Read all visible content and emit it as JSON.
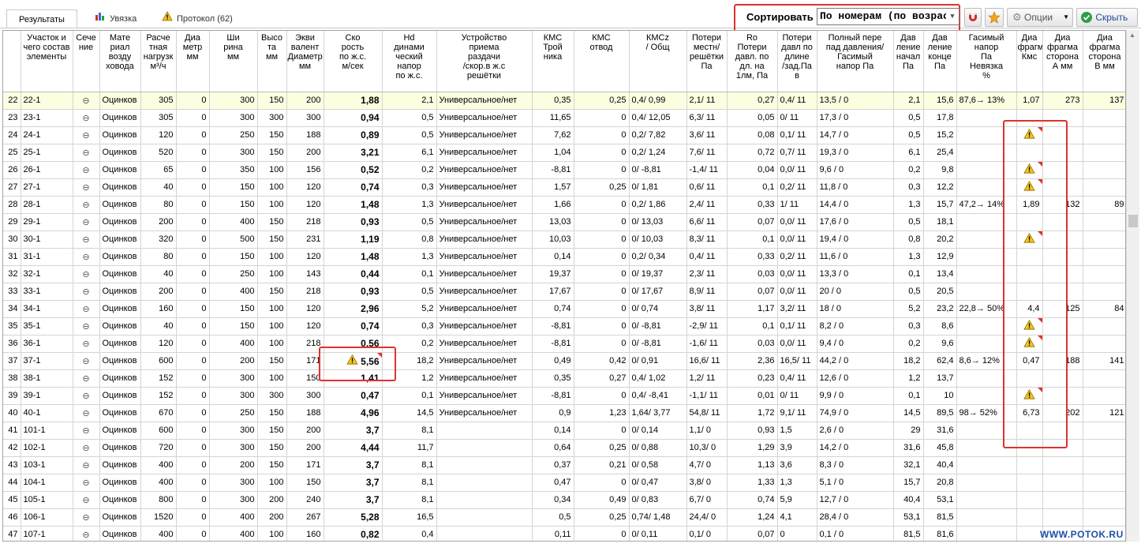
{
  "tabs": [
    {
      "label": "Результаты",
      "icon": "results-tab"
    },
    {
      "label": "Увязка",
      "icon": "bar-chart-icon"
    },
    {
      "label": "Протокол (62)",
      "icon": "warning-icon"
    }
  ],
  "sort": {
    "label": "Сортировать",
    "value": "По номерам (по возрастанию)"
  },
  "toolbar": {
    "options_label": "Опции",
    "hide_label": "Скрыть"
  },
  "brand": "WWW.POTOK.RU",
  "columns": [
    "",
    "Участок и\nчего состав\nэлементы",
    "Сече\nние",
    "Мате\nриал\nвозду\nховода",
    "Расче\nтная\nнагрузк\nм³/ч",
    "Диа\nметр\nмм",
    "Ши\nрина\nмм",
    "Высо\nта\nмм",
    "Экви\nвалент\nДиаметр\nмм",
    "Ско\nрость\nпо ж.с.\nм/сек",
    "Hd\nдинами\nческий\nнапор\nпо ж.с.",
    "Устройство\nприема\nраздачи\n/скор.в ж.с\nрешётки",
    "КМС\nТрой\nника",
    "КМС\nотвод",
    "КМСz\n/ Общ",
    "Потери\nместн/\nрешётки\nПа",
    "Ro\nПотери\nдавл. по\nдл. на\n1лм, Па",
    "Потери\nдавл по\nдлине\n/зад.Па\nв",
    "Полный пере\nпад давления/\nГасимый\nнапор Па",
    "Дав\nление\nначал\nПа",
    "Дав\nление\nконце\nПа",
    "Гасимый\nнапор\nПа\nНевязка\n%",
    "Диа\nфрагма\nКмс",
    "Диа\nфрагма\nсторона\nА мм",
    "Диа\nфрагма\nсторона\nВ мм"
  ],
  "rows": [
    [
      "22",
      "22-1",
      "⊖",
      "Оцинков",
      "305",
      "0",
      "300",
      "150",
      "200",
      "1,88",
      "2,1",
      "Универсальное/нет",
      "0,35",
      "0,25",
      "0,4/ 0,99",
      "2,1/ 11",
      "0,27",
      "0,4/ 11",
      "13,5 / 0",
      "2,1",
      "15,6",
      "87,6→ 13%",
      "1,07",
      "273",
      "137"
    ],
    [
      "23",
      "23-1",
      "⊖",
      "Оцинков",
      "305",
      "0",
      "300",
      "300",
      "300",
      "0,94",
      "0,5",
      "Универсальное/нет",
      "11,65",
      "0",
      "0,4/ 12,05",
      "6,3/ 11",
      "0,05",
      "0/ 11",
      "17,3 / 0",
      "0,5",
      "17,8",
      "",
      "",
      "",
      ""
    ],
    [
      "24",
      "24-1",
      "⊖",
      "Оцинков",
      "120",
      "0",
      "250",
      "150",
      "188",
      "0,89",
      "0,5",
      "Универсальное/нет",
      "7,62",
      "0",
      "0,2/ 7,82",
      "3,6/ 11",
      "0,08",
      "0,1/ 11",
      "14,7 / 0",
      "0,5",
      "15,2",
      "",
      "!",
      "",
      ""
    ],
    [
      "25",
      "25-1",
      "⊖",
      "Оцинков",
      "520",
      "0",
      "300",
      "150",
      "200",
      "3,21",
      "6,1",
      "Универсальное/нет",
      "1,04",
      "0",
      "0,2/ 1,24",
      "7,6/ 11",
      "0,72",
      "0,7/ 11",
      "19,3 / 0",
      "6,1",
      "25,4",
      "",
      "",
      "",
      ""
    ],
    [
      "26",
      "26-1",
      "⊖",
      "Оцинков",
      "65",
      "0",
      "350",
      "100",
      "156",
      "0,52",
      "0,2",
      "Универсальное/нет",
      "-8,81",
      "0",
      "0/ -8,81",
      "-1,4/ 11",
      "0,04",
      "0,0/ 11",
      "9,6 / 0",
      "0,2",
      "9,8",
      "",
      "!",
      "",
      ""
    ],
    [
      "27",
      "27-1",
      "⊖",
      "Оцинков",
      "40",
      "0",
      "150",
      "100",
      "120",
      "0,74",
      "0,3",
      "Универсальное/нет",
      "1,57",
      "0,25",
      "0/ 1,81",
      "0,6/ 11",
      "0,1",
      "0,2/ 11",
      "11,8 / 0",
      "0,3",
      "12,2",
      "",
      "!",
      "",
      ""
    ],
    [
      "28",
      "28-1",
      "⊖",
      "Оцинков",
      "80",
      "0",
      "150",
      "100",
      "120",
      "1,48",
      "1,3",
      "Универсальное/нет",
      "1,66",
      "0",
      "0,2/ 1,86",
      "2,4/ 11",
      "0,33",
      "1/ 11",
      "14,4 / 0",
      "1,3",
      "15,7",
      "47,2→ 14%",
      "1,89",
      "132",
      "89"
    ],
    [
      "29",
      "29-1",
      "⊖",
      "Оцинков",
      "200",
      "0",
      "400",
      "150",
      "218",
      "0,93",
      "0,5",
      "Универсальное/нет",
      "13,03",
      "0",
      "0/ 13,03",
      "6,6/ 11",
      "0,07",
      "0,0/ 11",
      "17,6 / 0",
      "0,5",
      "18,1",
      "",
      "",
      "",
      ""
    ],
    [
      "30",
      "30-1",
      "⊖",
      "Оцинков",
      "320",
      "0",
      "500",
      "150",
      "231",
      "1,19",
      "0,8",
      "Универсальное/нет",
      "10,03",
      "0",
      "0/ 10,03",
      "8,3/ 11",
      "0,1",
      "0,0/ 11",
      "19,4 / 0",
      "0,8",
      "20,2",
      "",
      "!",
      "",
      ""
    ],
    [
      "31",
      "31-1",
      "⊖",
      "Оцинков",
      "80",
      "0",
      "150",
      "100",
      "120",
      "1,48",
      "1,3",
      "Универсальное/нет",
      "0,14",
      "0",
      "0,2/ 0,34",
      "0,4/ 11",
      "0,33",
      "0,2/ 11",
      "11,6 / 0",
      "1,3",
      "12,9",
      "",
      "",
      "",
      ""
    ],
    [
      "32",
      "32-1",
      "⊖",
      "Оцинков",
      "40",
      "0",
      "250",
      "100",
      "143",
      "0,44",
      "0,1",
      "Универсальное/нет",
      "19,37",
      "0",
      "0/ 19,37",
      "2,3/ 11",
      "0,03",
      "0,0/ 11",
      "13,3 / 0",
      "0,1",
      "13,4",
      "",
      "",
      "",
      ""
    ],
    [
      "33",
      "33-1",
      "⊖",
      "Оцинков",
      "200",
      "0",
      "400",
      "150",
      "218",
      "0,93",
      "0,5",
      "Универсальное/нет",
      "17,67",
      "0",
      "0/ 17,67",
      "8,9/ 11",
      "0,07",
      "0,0/ 11",
      "20 / 0",
      "0,5",
      "20,5",
      "",
      "",
      "",
      ""
    ],
    [
      "34",
      "34-1",
      "⊖",
      "Оцинков",
      "160",
      "0",
      "150",
      "100",
      "120",
      "2,96",
      "5,2",
      "Универсальное/нет",
      "0,74",
      "0",
      "0/ 0,74",
      "3,8/ 11",
      "1,17",
      "3,2/ 11",
      "18 / 0",
      "5,2",
      "23,2",
      "22,8→ 50%",
      "4,4",
      "125",
      "84"
    ],
    [
      "35",
      "35-1",
      "⊖",
      "Оцинков",
      "40",
      "0",
      "150",
      "100",
      "120",
      "0,74",
      "0,3",
      "Универсальное/нет",
      "-8,81",
      "0",
      "0/ -8,81",
      "-2,9/ 11",
      "0,1",
      "0,1/ 11",
      "8,2 / 0",
      "0,3",
      "8,6",
      "",
      "!",
      "",
      ""
    ],
    [
      "36",
      "36-1",
      "⊖",
      "Оцинков",
      "120",
      "0",
      "400",
      "100",
      "218",
      "0,56",
      "0,2",
      "Универсальное/нет",
      "-8,81",
      "0",
      "0/ -8,81",
      "-1,6/ 11",
      "0,03",
      "0,0/ 11",
      "9,4 / 0",
      "0,2",
      "9,6",
      "",
      "!",
      "",
      ""
    ],
    [
      "37",
      "37-1",
      "⊖",
      "Оцинков",
      "600",
      "0",
      "200",
      "150",
      "171",
      "!5,56",
      "18,2",
      "Универсальное/нет",
      "0,49",
      "0,42",
      "0/ 0,91",
      "16,6/ 11",
      "2,36",
      "16,5/ 11",
      "44,2 / 0",
      "18,2",
      "62,4",
      "8,6→ 12%",
      "0,47",
      "188",
      "141"
    ],
    [
      "38",
      "38-1",
      "⊖",
      "Оцинков",
      "152",
      "0",
      "300",
      "100",
      "150",
      "1,41",
      "1,2",
      "Универсальное/нет",
      "0,35",
      "0,27",
      "0,4/ 1,02",
      "1,2/ 11",
      "0,23",
      "0,4/ 11",
      "12,6 / 0",
      "1,2",
      "13,7",
      "",
      "",
      "",
      ""
    ],
    [
      "39",
      "39-1",
      "⊖",
      "Оцинков",
      "152",
      "0",
      "300",
      "300",
      "300",
      "0,47",
      "0,1",
      "Универсальное/нет",
      "-8,81",
      "0",
      "0,4/ -8,41",
      "-1,1/ 11",
      "0,01",
      "0/ 11",
      "9,9 / 0",
      "0,1",
      "10",
      "",
      "!",
      "",
      ""
    ],
    [
      "40",
      "40-1",
      "⊖",
      "Оцинков",
      "670",
      "0",
      "250",
      "150",
      "188",
      "4,96",
      "14,5",
      "Универсальное/нет",
      "0,9",
      "1,23",
      "1,64/ 3,77",
      "54,8/ 11",
      "1,72",
      "9,1/ 11",
      "74,9 / 0",
      "14,5",
      "89,5",
      "98→ 52%",
      "6,73",
      "202",
      "121"
    ],
    [
      "41",
      "101-1",
      "⊖",
      "Оцинков",
      "600",
      "0",
      "300",
      "150",
      "200",
      "3,7",
      "8,1",
      "",
      "0,14",
      "0",
      "0/ 0,14",
      "1,1/ 0",
      "0,93",
      "1,5",
      "2,6 / 0",
      "29",
      "31,6",
      "",
      "",
      "",
      ""
    ],
    [
      "42",
      "102-1",
      "⊖",
      "Оцинков",
      "720",
      "0",
      "300",
      "150",
      "200",
      "4,44",
      "11,7",
      "",
      "0,64",
      "0,25",
      "0/ 0,88",
      "10,3/ 0",
      "1,29",
      "3,9",
      "14,2 / 0",
      "31,6",
      "45,8",
      "",
      "",
      "",
      ""
    ],
    [
      "43",
      "103-1",
      "⊖",
      "Оцинков",
      "400",
      "0",
      "200",
      "150",
      "171",
      "3,7",
      "8,1",
      "",
      "0,37",
      "0,21",
      "0/ 0,58",
      "4,7/ 0",
      "1,13",
      "3,6",
      "8,3 / 0",
      "32,1",
      "40,4",
      "",
      "",
      "",
      ""
    ],
    [
      "44",
      "104-1",
      "⊖",
      "Оцинков",
      "400",
      "0",
      "300",
      "100",
      "150",
      "3,7",
      "8,1",
      "",
      "0,47",
      "0",
      "0/ 0,47",
      "3,8/ 0",
      "1,33",
      "1,3",
      "5,1 / 0",
      "15,7",
      "20,8",
      "",
      "",
      "",
      ""
    ],
    [
      "45",
      "105-1",
      "⊖",
      "Оцинков",
      "800",
      "0",
      "300",
      "200",
      "240",
      "3,7",
      "8,1",
      "",
      "0,34",
      "0,49",
      "0/ 0,83",
      "6,7/ 0",
      "0,74",
      "5,9",
      "12,7 / 0",
      "40,4",
      "53,1",
      "",
      "",
      "",
      ""
    ],
    [
      "46",
      "106-1",
      "⊖",
      "Оцинков",
      "1520",
      "0",
      "400",
      "200",
      "267",
      "5,28",
      "16,5",
      "",
      "0,5",
      "0,25",
      "0,74/ 1,48",
      "24,4/ 0",
      "1,24",
      "4,1",
      "28,4 / 0",
      "53,1",
      "81,5",
      "",
      "",
      "",
      ""
    ],
    [
      "47",
      "107-1",
      "⊖",
      "Оцинков",
      "400",
      "0",
      "400",
      "100",
      "160",
      "0,82",
      "0,4",
      "",
      "0,11",
      "0",
      "0/ 0,11",
      "0,1/ 0",
      "0,07",
      "0",
      "0,1 / 0",
      "81,5",
      "81,6",
      "",
      "",
      "",
      ""
    ]
  ]
}
